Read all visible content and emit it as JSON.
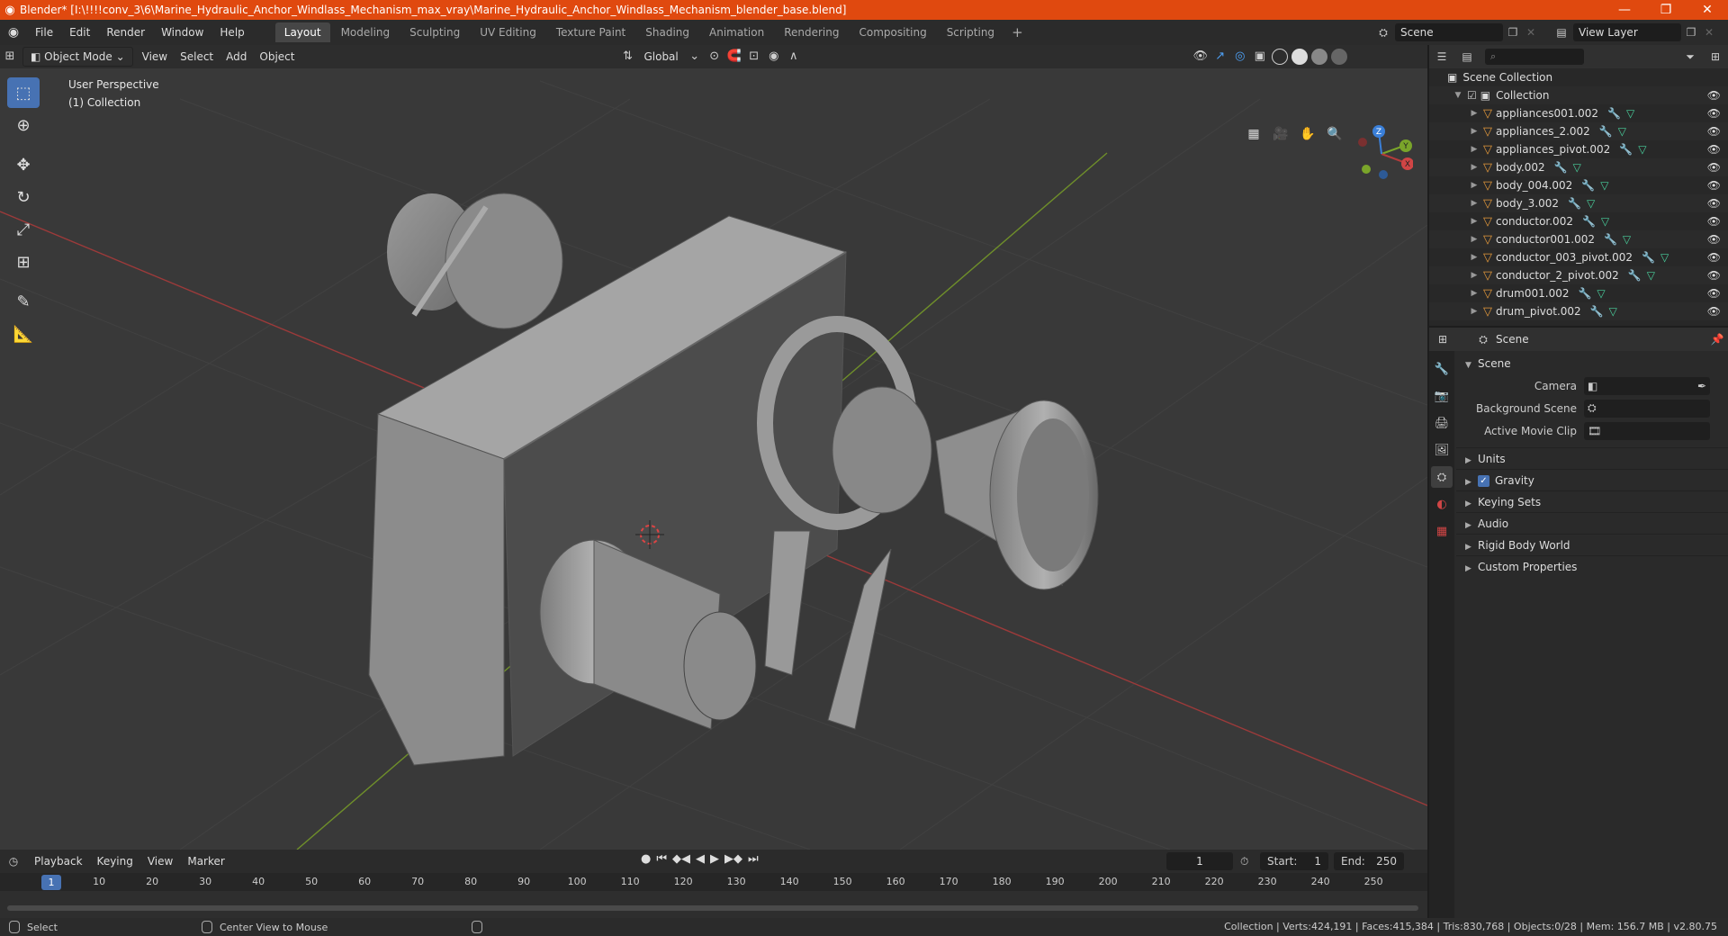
{
  "window": {
    "title": "Blender* [I:\\!!!!conv_3\\6\\Marine_Hydraulic_Anchor_Windlass_Mechanism_max_vray\\Marine_Hydraulic_Anchor_Windlass_Mechanism_blender_base.blend]"
  },
  "menubar": {
    "items": [
      "File",
      "Edit",
      "Render",
      "Window",
      "Help"
    ],
    "workspaces": [
      "Layout",
      "Modeling",
      "Sculpting",
      "UV Editing",
      "Texture Paint",
      "Shading",
      "Animation",
      "Rendering",
      "Compositing",
      "Scripting"
    ],
    "active_workspace": "Layout",
    "scene": "Scene",
    "view_layer": "View Layer"
  },
  "viewport": {
    "mode": "Object Mode",
    "menus": [
      "View",
      "Select",
      "Add",
      "Object"
    ],
    "orientation": "Global",
    "perspective_label": "User Perspective",
    "collection_label": "(1) Collection",
    "gizmo_axes": {
      "x": "X",
      "y": "Y",
      "z": "Z"
    },
    "colors": {
      "x_axis": "#b33b3b",
      "y_axis": "#7aa52a",
      "z_axis": "#3a7fd8",
      "accent": "#4772b3"
    }
  },
  "outliner": {
    "root": "Scene Collection",
    "collection": "Collection",
    "objects": [
      "appliances001.002",
      "appliances_2.002",
      "appliances_pivot.002",
      "body.002",
      "body_004.002",
      "body_3.002",
      "conductor.002",
      "conductor001.002",
      "conductor_003_pivot.002",
      "conductor_2_pivot.002",
      "drum001.002",
      "drum_pivot.002"
    ]
  },
  "properties": {
    "header_title": "Scene",
    "panel_title": "Scene",
    "fields": [
      {
        "label": "Camera"
      },
      {
        "label": "Background Scene"
      },
      {
        "label": "Active Movie Clip"
      }
    ],
    "subpanels": [
      "Units",
      "Gravity",
      "Keying Sets",
      "Audio",
      "Rigid Body World",
      "Custom Properties"
    ]
  },
  "timeline": {
    "menus": [
      "Playback",
      "Keying",
      "View",
      "Marker"
    ],
    "current_frame": "1",
    "start_label": "Start:",
    "start": "1",
    "end_label": "End:",
    "end": "250",
    "ticks": [
      "1",
      "10",
      "20",
      "30",
      "40",
      "50",
      "60",
      "70",
      "80",
      "90",
      "100",
      "110",
      "120",
      "130",
      "140",
      "150",
      "160",
      "170",
      "180",
      "190",
      "200",
      "210",
      "220",
      "230",
      "240",
      "250"
    ]
  },
  "statusbar": {
    "left_action": "Select",
    "middle_action": "Center View to Mouse",
    "stats": "Collection | Verts:424,191 | Faces:415,384 | Tris:830,768 | Objects:0/28 | Mem: 156.7 MB | v2.80.75"
  }
}
